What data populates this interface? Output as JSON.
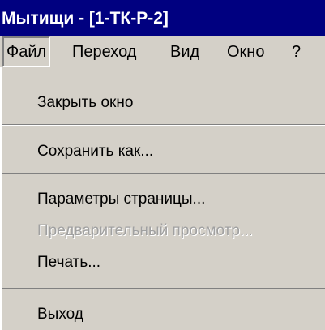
{
  "window": {
    "title": "Мытищи - [1-ТК-Р-2]"
  },
  "menubar": {
    "items": [
      {
        "label": "Файл"
      },
      {
        "label": "Переход"
      },
      {
        "label": "Вид"
      },
      {
        "label": "Окно"
      },
      {
        "label": "?"
      }
    ]
  },
  "file_menu": {
    "close_window": "Закрыть окно",
    "save_as": "Сохранить как...",
    "page_setup": "Параметры страницы...",
    "print_preview": "Предварительный просмотр...",
    "print": "Печать...",
    "exit": "Выход"
  },
  "colors": {
    "titlebar": "#000080",
    "menu_bg": "#d4d0c8",
    "disabled_text": "#a0a0a0"
  }
}
